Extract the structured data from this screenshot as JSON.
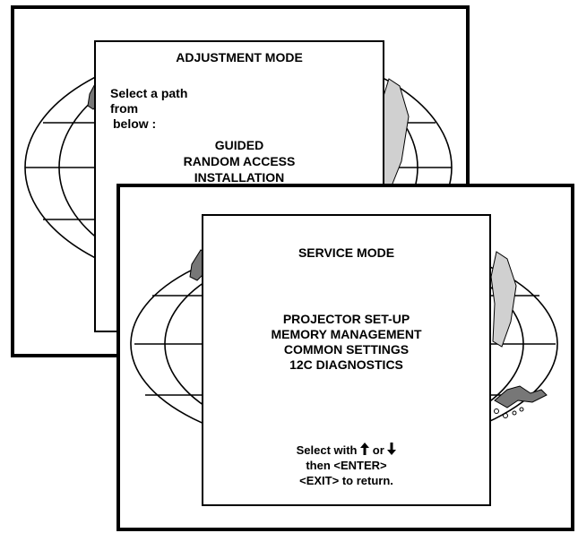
{
  "adjustment": {
    "title": "ADJUSTMENT MODE",
    "prompt_line1": "Select a path from",
    "prompt_line2": "below :",
    "options": [
      "GUIDED",
      "RANDOM ACCESS",
      "INSTALLATION"
    ]
  },
  "service": {
    "title": "SERVICE MODE",
    "options": [
      "PROJECTOR SET-UP",
      "MEMORY MANAGEMENT",
      "COMMON SETTINGS",
      "12C DIAGNOSTICS"
    ],
    "help_select_prefix": "Select with",
    "help_select_or": "or",
    "help_enter": "then  <ENTER>",
    "help_exit": "<EXIT>  to return.",
    "up_arrow_icon": "up-arrow-icon",
    "down_arrow_icon": "down-arrow-icon"
  }
}
